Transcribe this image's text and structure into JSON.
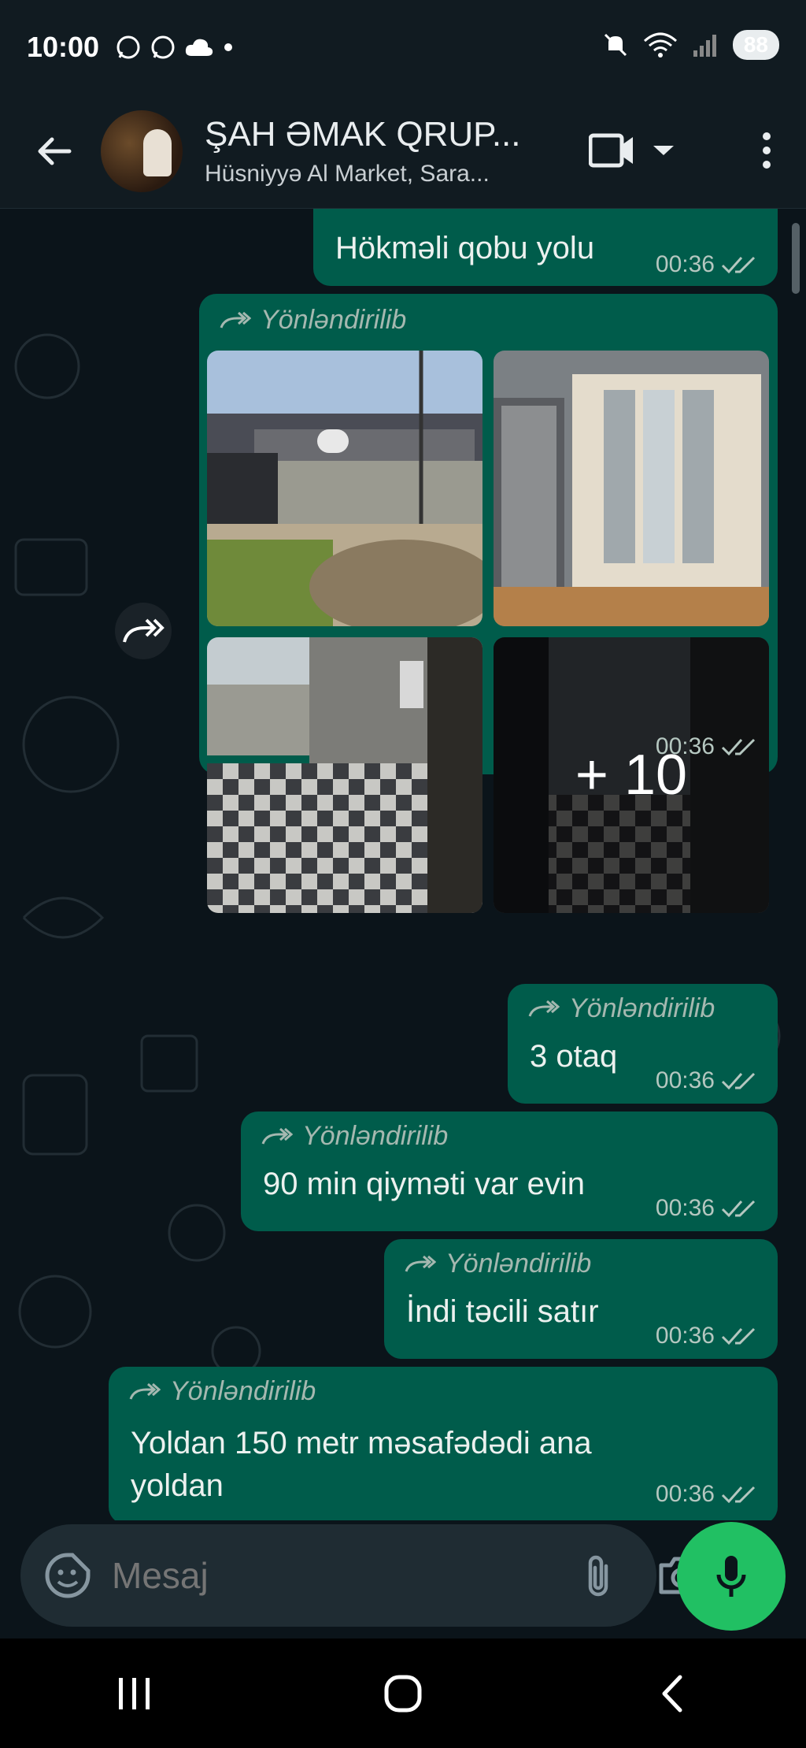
{
  "status_bar": {
    "time": "10:00",
    "battery": "88",
    "left_icons": [
      "whatsapp-icon",
      "whatsapp-icon",
      "cloud-icon",
      "dot-icon"
    ],
    "right_icons": [
      "mute-icon",
      "wifi-icon",
      "signal-icon",
      "battery-icon"
    ]
  },
  "header": {
    "title": "ŞAH ƏMAK QRUP...",
    "subtitle": "Hüsniyyə Al Market, Sara..."
  },
  "messages": {
    "m1": {
      "text": "Hökməli qobu yolu",
      "time": "00:36"
    },
    "album": {
      "forwarded": "Yönləndirilib",
      "more_count": "+ 10",
      "time": "00:36"
    },
    "m2": {
      "forwarded": "Yönləndirilib",
      "text": "3 otaq",
      "time": "00:36"
    },
    "m3": {
      "forwarded": "Yönləndirilib",
      "text": "90 min qiyməti var evin",
      "time": "00:36"
    },
    "m4": {
      "forwarded": "Yönləndirilib",
      "text": "İndi təcili satır",
      "time": "00:36"
    },
    "m5": {
      "forwarded": "Yönləndirilib",
      "text": "Yoldan 150 metr məsafədədi ana yoldan",
      "time": "00:36"
    }
  },
  "input": {
    "placeholder": "Mesaj"
  },
  "colors": {
    "bubble": "#005c4b",
    "background": "#0b141a",
    "accent": "#21c063"
  }
}
